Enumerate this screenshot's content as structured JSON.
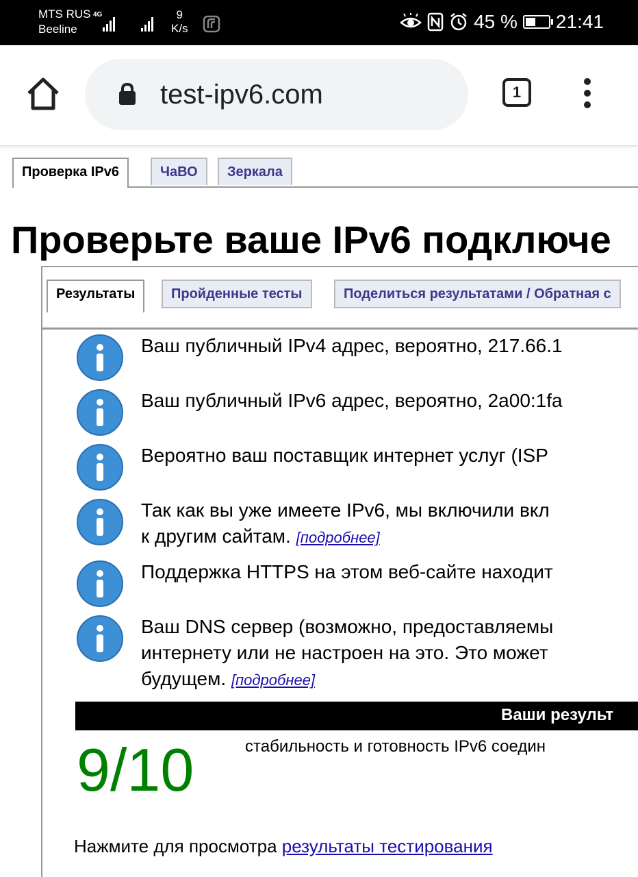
{
  "status_bar": {
    "carrier_1": "MTS RUS",
    "carrier_2": "Beeline",
    "network_tag": "4G",
    "speed_value": "9",
    "speed_unit": "K/s",
    "battery": "45 %",
    "battery_level": 0.45,
    "time": "21:41",
    "icons": [
      "eye-comfort-icon",
      "nfc-icon",
      "alarm-icon",
      "battery-icon"
    ]
  },
  "browser": {
    "url": "test-ipv6.com",
    "tab_count": "1"
  },
  "site_tabs": [
    "Проверка IPv6",
    "ЧаВО",
    "Зеркала"
  ],
  "page_title": "Проверьте ваше IPv6 подключе",
  "result_tabs": [
    "Результаты",
    "Пройденные тесты",
    "Поделиться результатами / Обратная с"
  ],
  "info_items": [
    {
      "line1": "Ваш публичный IPv4 адрес, вероятно, 217.66.1"
    },
    {
      "line1": "Ваш публичный IPv6 адрес, вероятно, 2a00:1fa"
    },
    {
      "line1": "Вероятно ваш поставщик интернет услуг (ISP"
    },
    {
      "line1": "Так как вы уже имеете IPv6, мы включили вкл",
      "line2": "к другим сайтам.",
      "link": "[подробнее]"
    },
    {
      "line1": "Поддержка HTTPS на этом веб-сайте находит"
    },
    {
      "line1": "Ваш DNS сервер (возможно, предоставляемы",
      "line2": "интернету или не настроен на это. Это может",
      "line3": "будущем.",
      "link": "[подробнее]"
    }
  ],
  "results": {
    "header": "Ваши результ",
    "score": "9/10",
    "description": "стабильность и готовность IPv6 соедин"
  },
  "view_results": {
    "prefix": "Нажмите для просмотра",
    "link": "результаты тестирования"
  }
}
